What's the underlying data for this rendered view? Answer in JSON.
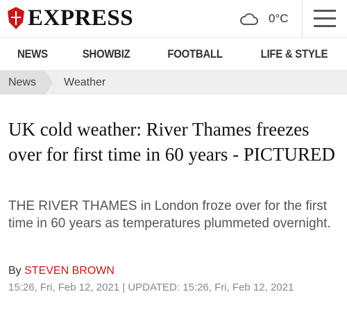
{
  "header": {
    "logo_text": "EXPRESS",
    "temperature": "0°C",
    "weather_icon": "cloud-icon",
    "menu_icon": "hamburger-menu-icon",
    "brand_color": "#c41a1a"
  },
  "nav": {
    "items": [
      {
        "label": "NEWS"
      },
      {
        "label": "SHOWBIZ"
      },
      {
        "label": "FOOTBALL"
      },
      {
        "label": "LIFE & STYLE"
      }
    ]
  },
  "breadcrumb": {
    "items": [
      {
        "label": "News"
      },
      {
        "label": "Weather"
      }
    ]
  },
  "article": {
    "headline": "UK cold weather: River Thames freezes over for first time in 60 years - PICTURED",
    "standfirst": "THE RIVER THAMES in London froze over for the first time in 60 years as temperatures plummeted overnight.",
    "by_prefix": "By",
    "author": "STEVEN BROWN",
    "dates": "15:26, Fri, Feb 12, 2021 | UPDATED: 15:26, Fri, Feb 12, 2021"
  }
}
